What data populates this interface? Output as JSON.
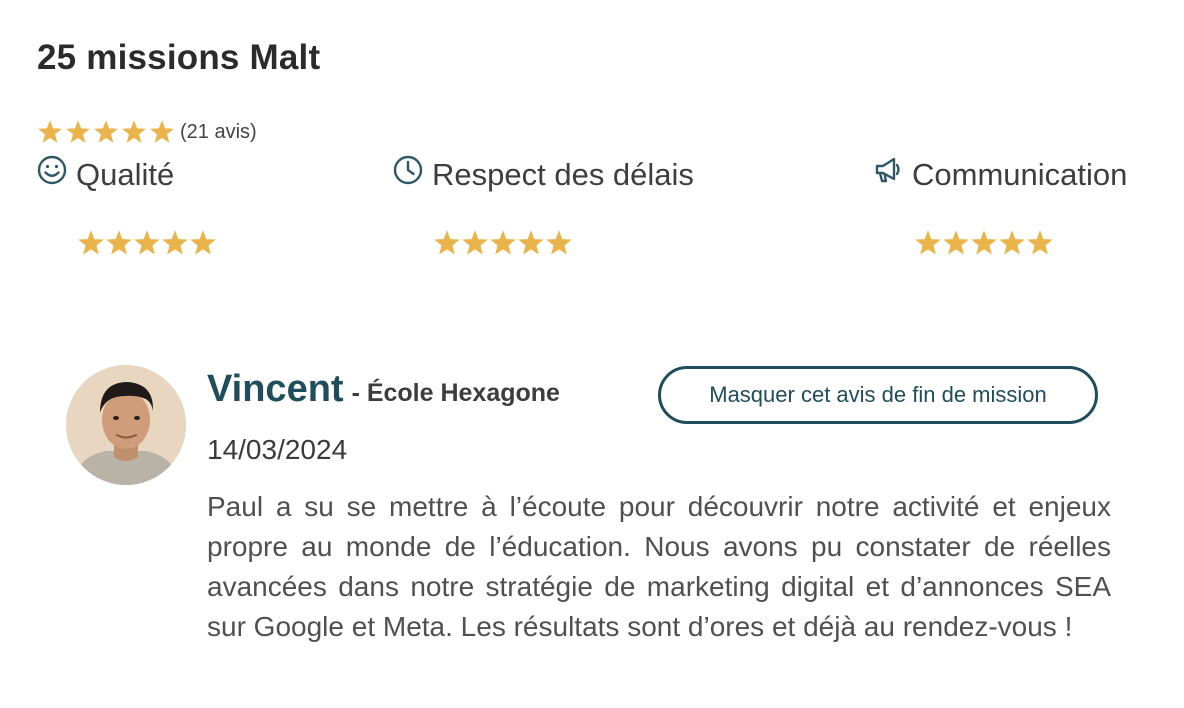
{
  "header": {
    "title": "25 missions Malt"
  },
  "rating": {
    "star_color": "#EBB44B",
    "overall": {
      "value": 5,
      "max": 5,
      "count_label": "(21 avis)"
    },
    "categories": [
      {
        "label": "Qualité",
        "icon": "smiley-icon",
        "value": 5,
        "max": 5
      },
      {
        "label": "Respect des délais",
        "icon": "clock-icon",
        "value": 5,
        "max": 5
      },
      {
        "label": "Communication",
        "icon": "megaphone-icon",
        "value": 5,
        "max": 5
      }
    ]
  },
  "review": {
    "name": "Vincent",
    "company": "- École Hexagone",
    "date": "14/03/2024",
    "hide_button_label": "Masquer cet avis de fin de mission",
    "text": "Paul a su se mettre à l’écoute pour découvrir notre activité et enjeux propre au monde de l’éducation. Nous avons pu constater de réelles avancées dans notre stratégie de marketing digital et d’annonces SEA sur Google et Meta. Les résultats sont d’ores et déjà au rendez-vous !"
  },
  "colors": {
    "accent": "#1F4D5C",
    "icon": "#2E5866"
  }
}
